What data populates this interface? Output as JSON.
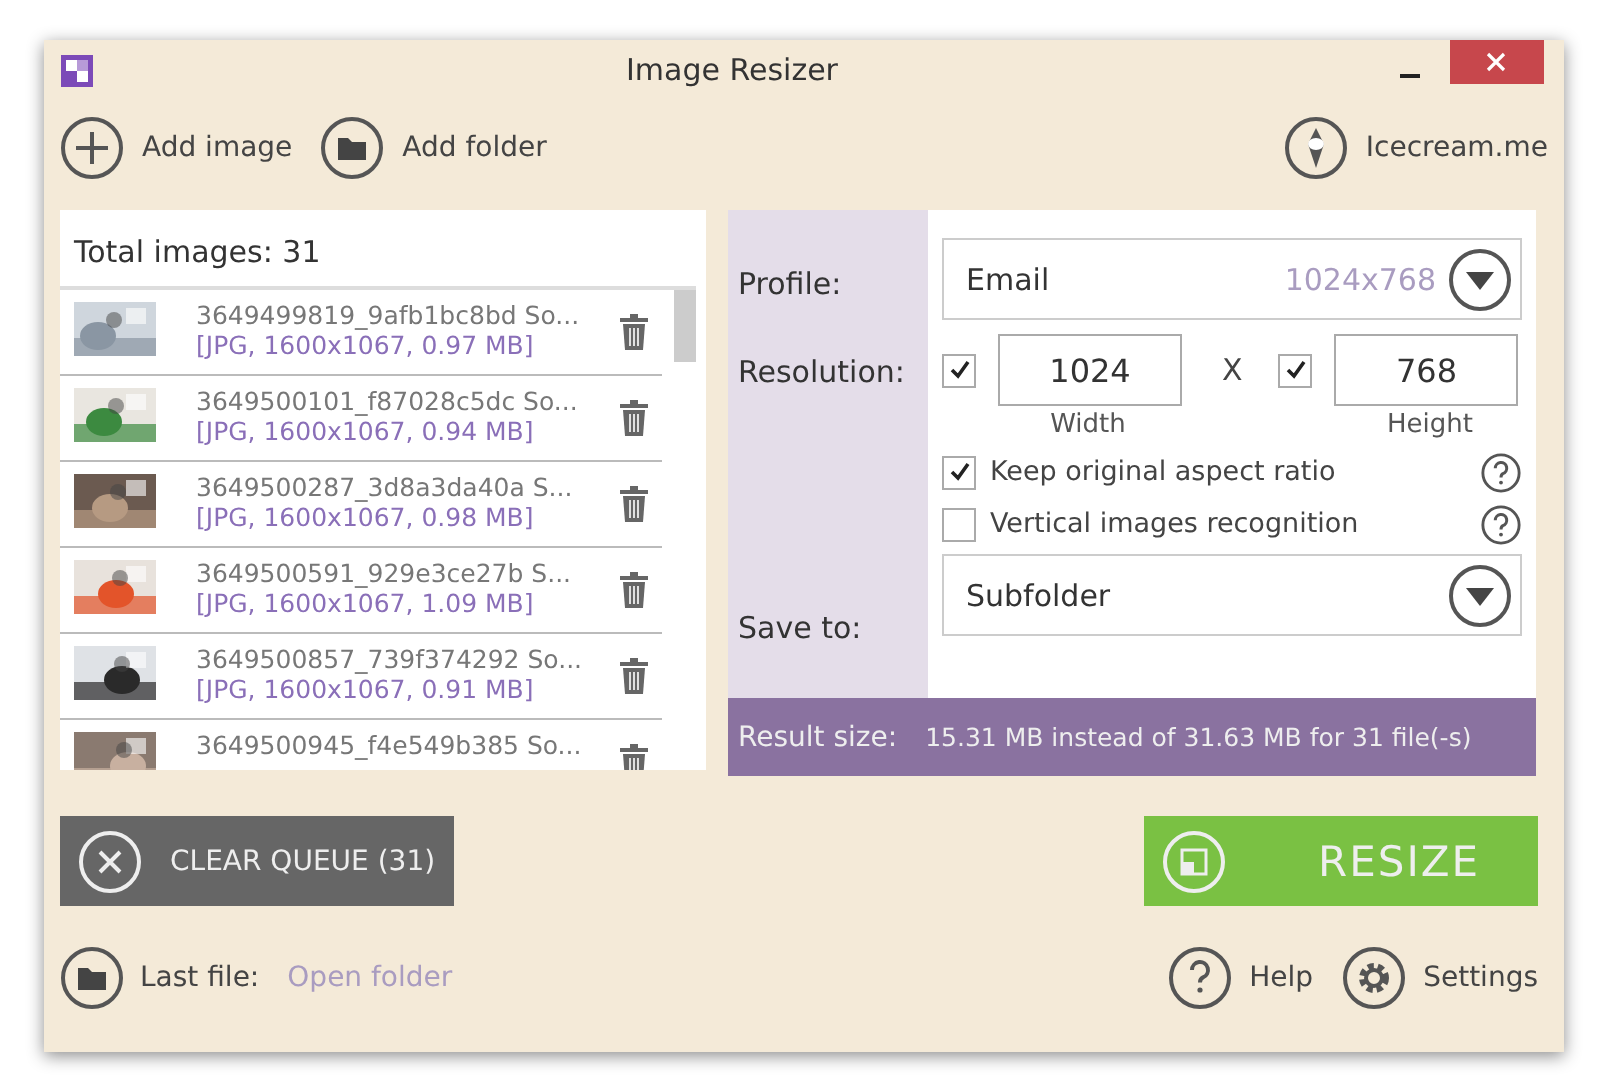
{
  "window": {
    "title": "Image Resizer"
  },
  "toolbar": [
    {
      "kind": "add",
      "label": "Add image"
    },
    {
      "kind": "folder",
      "label": "Add folder"
    }
  ],
  "brand": {
    "label": "Icecream.me"
  },
  "queue": {
    "total": "Total images: 31",
    "files": [
      {
        "name": "3649499819_9afb1bc8bd So...",
        "info": "[JPG, 1600x1067, 0.97 MB]"
      },
      {
        "name": "3649500101_f87028c5dc So...",
        "info": "[JPG, 1600x1067, 0.94 MB]"
      },
      {
        "name": "3649500287_3d8a3da40a S...",
        "info": "[JPG, 1600x1067, 0.98 MB]"
      },
      {
        "name": "3649500591_929e3ce27b S...",
        "info": "[JPG, 1600x1067, 1.09 MB]"
      },
      {
        "name": "3649500857_739f374292 So...",
        "info": "[JPG, 1600x1067, 0.91 MB]"
      },
      {
        "name": "3649500945_f4e549b385 So..."
      }
    ]
  },
  "settings": {
    "profile_label": "Profile:",
    "profile": "Email",
    "profile_size": "1024x768",
    "resolution_label": "Resolution:",
    "width": {
      "value": "1024",
      "caption": "Width",
      "checked": true
    },
    "separator": "X",
    "height": {
      "value": "768",
      "caption": "Height",
      "checked": true
    },
    "options": [
      {
        "label": "Keep original aspect ratio",
        "checked": true
      },
      {
        "label": "Vertical images recognition",
        "checked": false
      }
    ],
    "save_label": "Save to:",
    "save_to": "Subfolder",
    "result_label": "Result size:",
    "result": "15.31 MB instead of 31.63 MB for 31 file(-s)"
  },
  "clear_button": "CLEAR QUEUE (31)",
  "resize_button": "RESIZE",
  "footer": {
    "last_file_label": "Last file:",
    "open_folder": "Open folder",
    "help": "Help",
    "settings": "Settings"
  }
}
